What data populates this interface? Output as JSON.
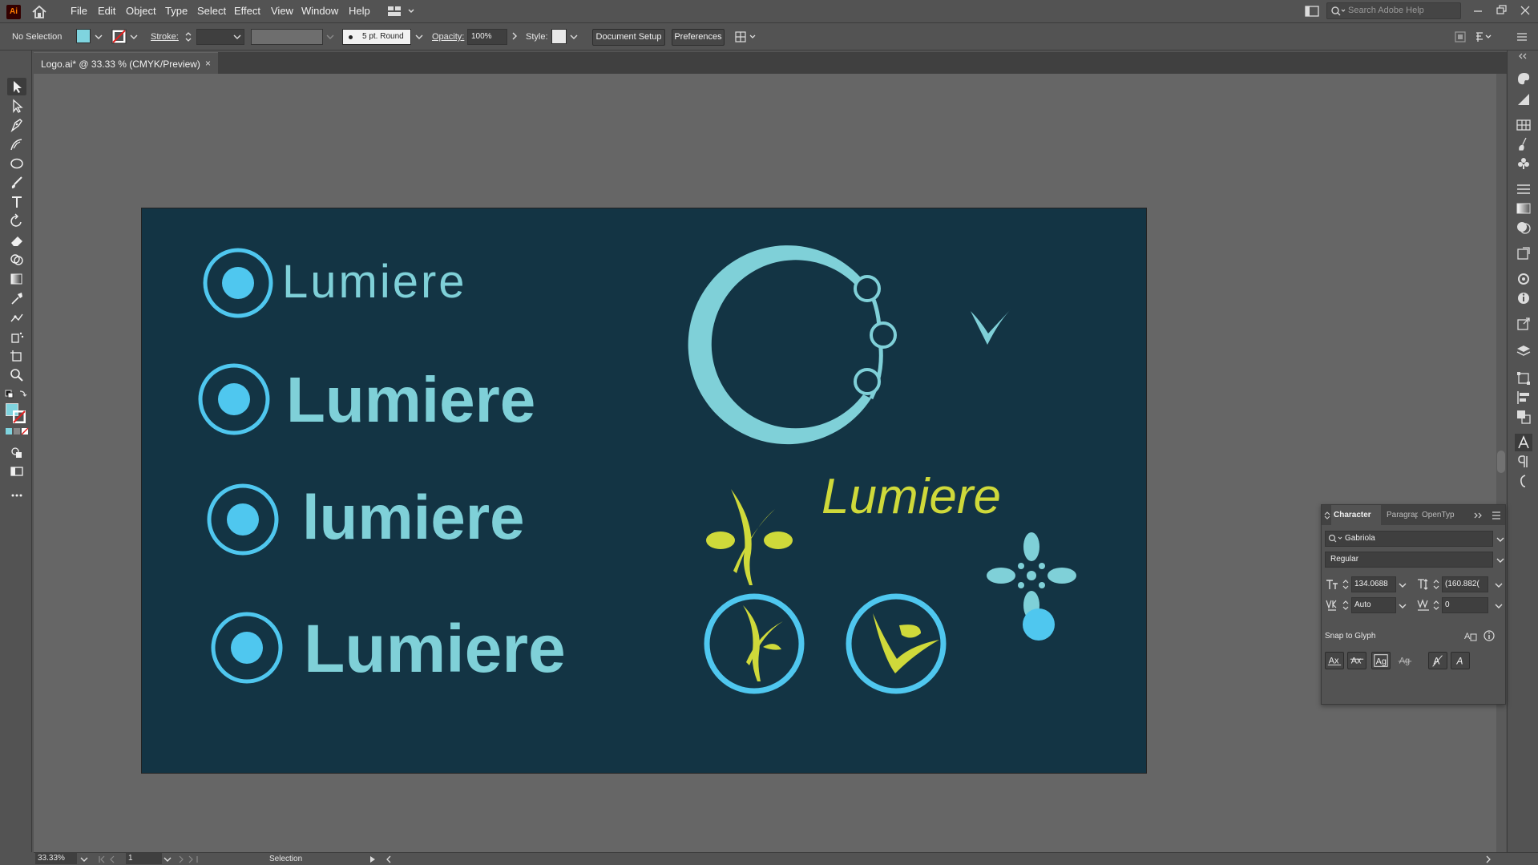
{
  "app": {
    "logo_text": "Ai",
    "menu": [
      "File",
      "Edit",
      "Object",
      "Type",
      "Select",
      "Effect",
      "View",
      "Window",
      "Help"
    ],
    "search_placeholder": "Search Adobe Help"
  },
  "control_bar": {
    "selection_label": "No Selection",
    "fill_color": "#7fd4df",
    "stroke_label": "Stroke:",
    "brush_label": "5 pt. Round",
    "opacity_label": "Opacity:",
    "opacity_value": "100%",
    "style_label": "Style:",
    "document_setup": "Document Setup",
    "preferences": "Preferences"
  },
  "tab": {
    "title": "Logo.ai* @ 33.33 % (CMYK/Preview)",
    "close": "×"
  },
  "artboard": {
    "background": "#133444",
    "wordmarks": [
      "Lumiere",
      "Lumiere",
      "lumiere",
      "Lumiere"
    ],
    "script_wordmark": "Lumiere",
    "colors": {
      "teal": "#7fd0d8",
      "blue": "#4fc7ef",
      "lime": "#cfd93a"
    }
  },
  "character_panel": {
    "tabs": [
      "Character",
      "Paragrap",
      "OpenTyp"
    ],
    "font_family": "Gabriola",
    "font_style": "Regular",
    "font_size": "134.0688",
    "leading": "(160.882(",
    "kerning": "Auto",
    "tracking": "0",
    "snap_label": "Snap to Glyph"
  },
  "status_bar": {
    "zoom": "33.33%",
    "page": "1",
    "tool": "Selection"
  }
}
